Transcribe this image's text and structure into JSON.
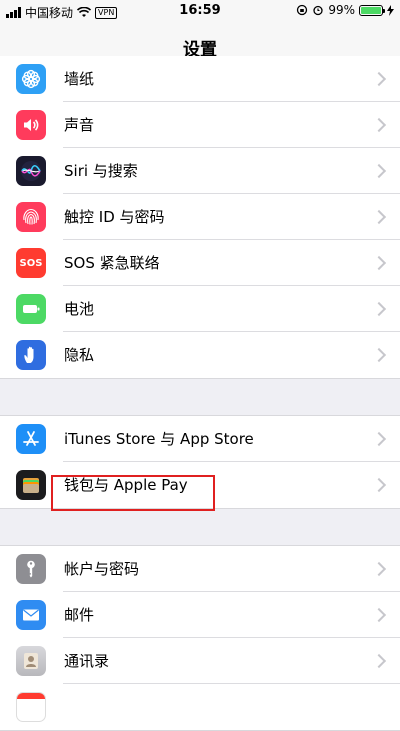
{
  "status_bar": {
    "carrier": "中国移动",
    "vpn": "VPN",
    "time": "16:59",
    "battery": "99%"
  },
  "nav": {
    "title": "设置"
  },
  "groups": [
    {
      "items": [
        {
          "label": "墙纸",
          "icon": "wallpaper-icon",
          "color": "#2ea0f5"
        },
        {
          "label": "声音",
          "icon": "sound-icon",
          "color": "#ff3b5c"
        },
        {
          "label": "Siri 与搜索",
          "icon": "siri-icon",
          "color": "#1a1a2e"
        },
        {
          "label": "触控 ID 与密码",
          "icon": "fingerprint-icon",
          "color": "#ff3b5c"
        },
        {
          "label": "SOS 紧急联络",
          "icon": "sos-icon",
          "color": "#ff3b30"
        },
        {
          "label": "电池",
          "icon": "battery-icon",
          "color": "#4cd964"
        },
        {
          "label": "隐私",
          "icon": "privacy-hand-icon",
          "color": "#2f6de0"
        }
      ]
    },
    {
      "items": [
        {
          "label": "iTunes Store 与 App Store",
          "icon": "app-store-icon",
          "color": "#1e8ff7"
        },
        {
          "label": "钱包与 Apple Pay",
          "icon": "wallet-icon",
          "color": "#1c1c1e"
        }
      ]
    },
    {
      "items": [
        {
          "label": "帐户与密码",
          "icon": "key-icon",
          "color": "#8e8e93"
        },
        {
          "label": "邮件",
          "icon": "mail-icon",
          "color": "#2f8cf2"
        },
        {
          "label": "通讯录",
          "icon": "contacts-icon",
          "color": "#c8c8cc"
        }
      ]
    }
  ],
  "highlighted_item": "钱包与 Apple Pay"
}
